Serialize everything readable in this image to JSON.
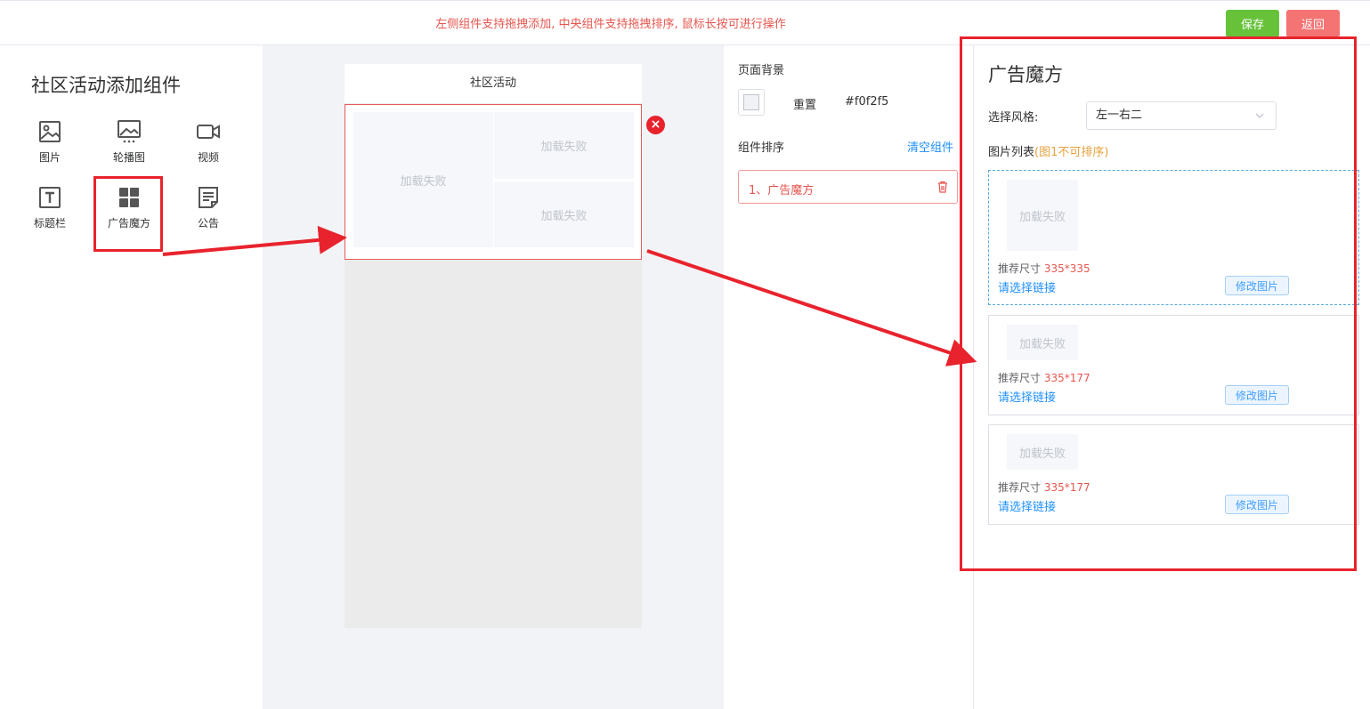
{
  "topbar": {
    "hint": "左侧组件支持拖拽添加, 中央组件支持拖拽排序, 鼠标长按可进行操作",
    "save_label": "保存",
    "back_label": "返回"
  },
  "left": {
    "title": "社区活动添加组件",
    "components": [
      {
        "label": "图片",
        "icon": "image-icon"
      },
      {
        "label": "轮播图",
        "icon": "carousel-icon"
      },
      {
        "label": "视频",
        "icon": "video-icon"
      },
      {
        "label": "标题栏",
        "icon": "title-bar-icon"
      },
      {
        "label": "广告魔方",
        "icon": "grid-icon"
      },
      {
        "label": "公告",
        "icon": "notice-icon"
      }
    ]
  },
  "preview": {
    "header_title": "社区活动",
    "load_failed": "加载失败"
  },
  "settings": {
    "page_bg_label": "页面背景",
    "reset_label": "重置",
    "bg_color": "#f0f2f5",
    "sort_label": "组件排序",
    "clear_label": "清空组件",
    "sort_items": [
      "1、广告魔方"
    ]
  },
  "panel": {
    "title": "广告魔方",
    "style_label": "选择风格:",
    "style_value": "左一右二",
    "list_label": "图片列表",
    "list_note": "(图1不可排序)",
    "rec_prefix": "推荐尺寸",
    "link_label": "请选择链接",
    "edit_label": "修改图片",
    "load_failed": "加载失败",
    "items": [
      {
        "size": "335*335"
      },
      {
        "size": "335*177"
      },
      {
        "size": "335*177"
      }
    ]
  },
  "colors": {
    "accent_red": "#e8232d",
    "save_green": "#67c23a",
    "back_red": "#f47373",
    "link_blue": "#1e90ff"
  }
}
